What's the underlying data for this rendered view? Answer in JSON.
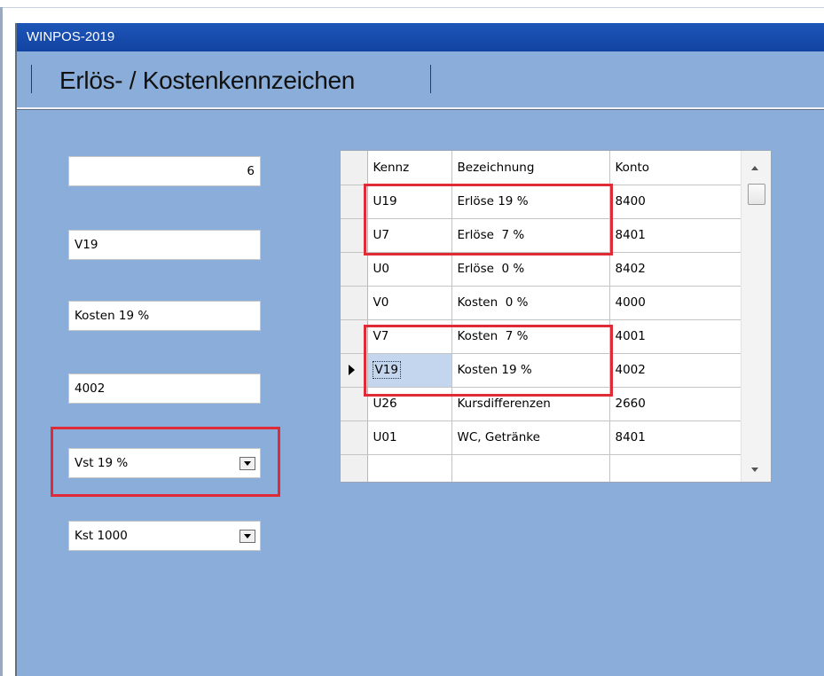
{
  "window": {
    "title": "WINPOS-2019"
  },
  "header": {
    "title": "Erlös- / Kostenkennzeichen"
  },
  "form": {
    "number_value": "6",
    "code_value": "V19",
    "description_value": "Kosten 19 %",
    "account_value": "4002",
    "tax_select": "Vst 19 %",
    "cost_center_select": "Kst 1000"
  },
  "grid": {
    "columns": [
      "Kennz",
      "Bezeichnung",
      "Konto"
    ],
    "rows": [
      {
        "kennz": "U19",
        "bezeichnung": "Erlöse 19 %",
        "konto": "8400"
      },
      {
        "kennz": "U7",
        "bezeichnung": "Erlöse  7 %",
        "konto": "8401"
      },
      {
        "kennz": "U0",
        "bezeichnung": "Erlöse  0 %",
        "konto": "8402"
      },
      {
        "kennz": "V0",
        "bezeichnung": "Kosten  0 %",
        "konto": "4000"
      },
      {
        "kennz": "V7",
        "bezeichnung": "Kosten  7 %",
        "konto": "4001"
      },
      {
        "kennz": "V19",
        "bezeichnung": "Kosten 19 %",
        "konto": "4002"
      },
      {
        "kennz": "U26",
        "bezeichnung": "Kursdifferenzen",
        "konto": "2660"
      },
      {
        "kennz": "U01",
        "bezeichnung": "WC, Getränke",
        "konto": "8401"
      }
    ],
    "selected_row": "V19"
  },
  "icons": [
    "dropdown-arrow-icon",
    "row-pointer-icon",
    "scroll-up-icon",
    "scroll-down-icon"
  ],
  "colors": {
    "highlight_box": "#e02a36",
    "titlebar": "#1d56b8",
    "background": "#8badd9"
  }
}
